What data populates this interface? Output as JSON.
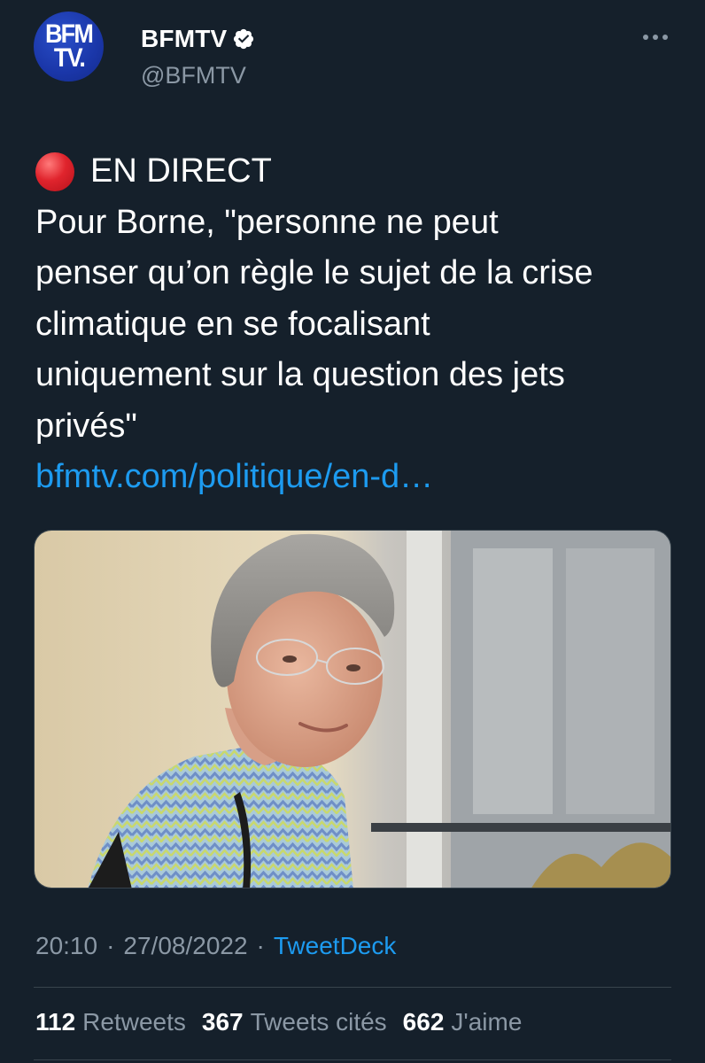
{
  "author": {
    "display_name": "BFMTV",
    "handle": "@BFMTV",
    "avatar_line1": "BFM",
    "avatar_line2": "TV.",
    "verified": true
  },
  "tweet": {
    "live_label": "EN DIRECT",
    "text_lines": [
      "Pour Borne, \"personne ne peut",
      "penser qu’on règle le sujet de la crise",
      "climatique en se focalisant",
      "uniquement sur la question des jets",
      "privés\""
    ],
    "link": "bfmtv.com/politique/en-d…",
    "time": "20:10",
    "separator": "·",
    "date": "27/08/2022",
    "source": "TweetDeck"
  },
  "stats": {
    "retweets_count": "112",
    "retweets_label": "Retweets",
    "quotes_count": "367",
    "quotes_label": "Tweets cités",
    "likes_count": "662",
    "likes_label": "J'aime"
  },
  "colors": {
    "background": "#15202b",
    "accent": "#1d9bf0",
    "muted": "#8b98a5",
    "divider": "#38444d",
    "live_red": "#e0242d"
  }
}
